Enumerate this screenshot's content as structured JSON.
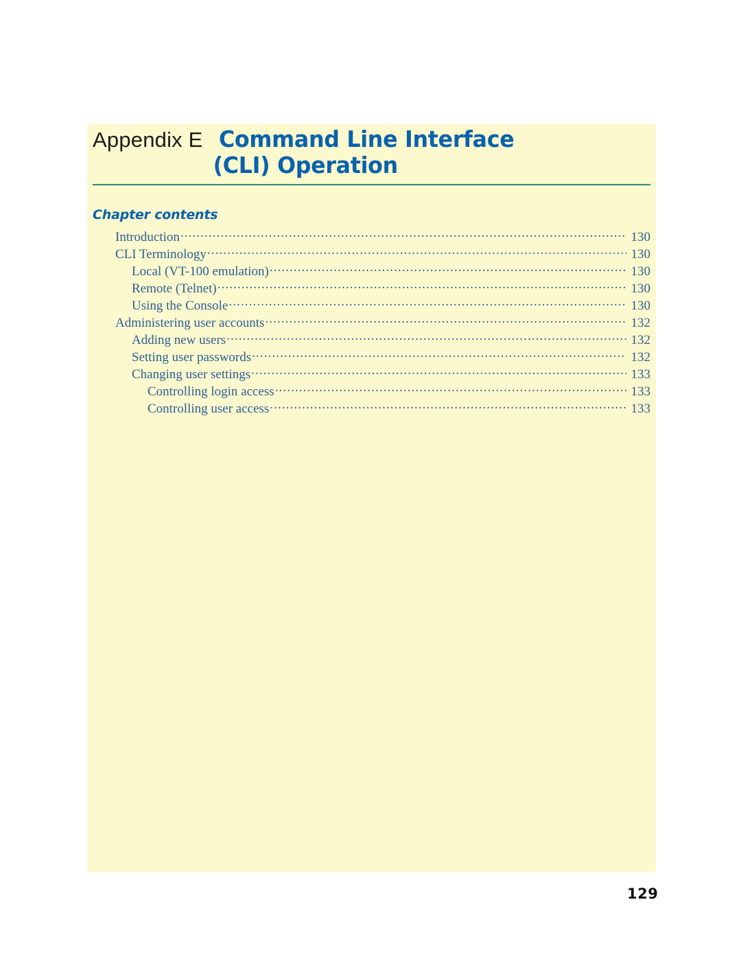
{
  "document": {
    "background_color": "#ffffff",
    "panel_color": "#fcf9ce",
    "accent_blue": "#0a62ac",
    "toc_blue": "#2c5f95",
    "rule_color": "#2e8a7d"
  },
  "chapter": {
    "appendix_label": "Appendix E",
    "title_line_1": "Command Line Interface",
    "title_line_2": "(CLI) Operation"
  },
  "contents": {
    "heading": "Chapter contents",
    "entries": [
      {
        "label": "Introduction",
        "page": "130",
        "level": 0
      },
      {
        "label": "CLI Terminology",
        "page": "130",
        "level": 0
      },
      {
        "label": "Local (VT-100 emulation)",
        "page": "130",
        "level": 1
      },
      {
        "label": "Remote (Telnet)",
        "page": "130",
        "level": 1
      },
      {
        "label": "Using the Console",
        "page": "130",
        "level": 1
      },
      {
        "label": "Administering user accounts",
        "page": "132",
        "level": 0
      },
      {
        "label": "Adding new users",
        "page": "132",
        "level": 1
      },
      {
        "label": "Setting user passwords",
        "page": "132",
        "level": 1
      },
      {
        "label": "Changing user settings",
        "page": "133",
        "level": 1
      },
      {
        "label": "Controlling login access",
        "page": "133",
        "level": 2
      },
      {
        "label": "Controlling user access",
        "page": "133",
        "level": 2
      }
    ]
  },
  "footer": {
    "page_number": "129"
  }
}
